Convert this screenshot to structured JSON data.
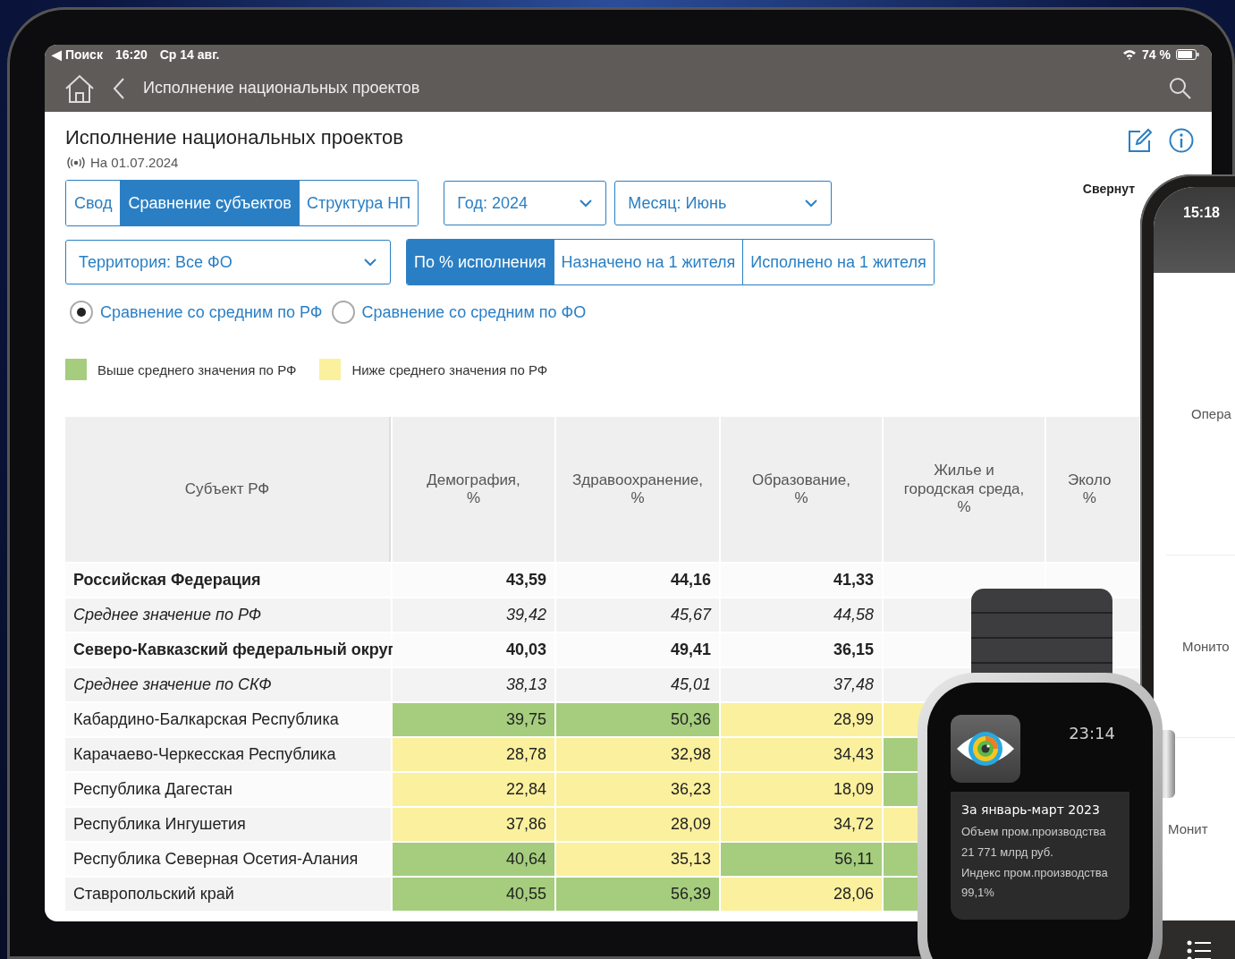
{
  "status_bar": {
    "back_label": "◀ Поиск",
    "time": "16:20",
    "date": "Ср 14 авг.",
    "battery": "74 %"
  },
  "nav_bar": {
    "title": "Исполнение национальных проектов"
  },
  "page": {
    "title": "Исполнение национальных проектов",
    "updated": "На 01.07.2024",
    "collapse": "Свернут"
  },
  "view_tabs": [
    {
      "label": "Свод",
      "selected": false
    },
    {
      "label": "Сравнение субъектов",
      "selected": true
    },
    {
      "label": "Структура НП",
      "selected": false
    }
  ],
  "year_select": {
    "value": "Год: 2024"
  },
  "month_select": {
    "value": "Месяц: Июнь"
  },
  "territory_select": {
    "value": "Территория: Все ФО"
  },
  "metric_tabs": [
    {
      "label": "По % исполнения",
      "selected": true
    },
    {
      "label": "Назначено на 1 жителя",
      "selected": false
    },
    {
      "label": "Исполнено на 1 жителя",
      "selected": false
    }
  ],
  "comparison": [
    {
      "label": "Сравнение со средним по РФ",
      "selected": true
    },
    {
      "label": "Сравнение со средним по ФО",
      "selected": false
    }
  ],
  "legend": [
    {
      "label": "Выше среднего значения по РФ",
      "color": "#a5cd7d"
    },
    {
      "label": "Ниже среднего значения по РФ",
      "color": "#fbf09d"
    }
  ],
  "table": {
    "row_header": "Субъект РФ",
    "columns": [
      "Демография,\n%",
      "Здравоохранение,\n%",
      "Образование,\n%",
      "Жилье и\nгородская среда,\n%",
      "Эколо\n%"
    ],
    "rows": [
      {
        "kind": "total",
        "name": "Российская Федерация",
        "cells": [
          {
            "value": "43,59"
          },
          {
            "value": "44,16"
          },
          {
            "value": "41,33"
          }
        ]
      },
      {
        "kind": "average",
        "name": "Среднее значение по РФ",
        "cells": [
          {
            "value": "39,42"
          },
          {
            "value": "45,67"
          },
          {
            "value": "44,58"
          }
        ]
      },
      {
        "kind": "total",
        "name": "Северо-Кавказский федеральный округ",
        "cells": [
          {
            "value": "40,03"
          },
          {
            "value": "49,41"
          },
          {
            "value": "36,15"
          }
        ]
      },
      {
        "kind": "average",
        "name": "Среднее значение по СКФ",
        "cells": [
          {
            "value": "38,13"
          },
          {
            "value": "45,01"
          },
          {
            "value": "37,48"
          }
        ]
      },
      {
        "kind": "region",
        "name": "Кабардино-Балкарская Республика",
        "cells": [
          {
            "value": "39,75",
            "color": "#a5cd7d"
          },
          {
            "value": "50,36",
            "color": "#a5cd7d"
          },
          {
            "value": "28,99",
            "color": "#fbf09d"
          },
          {
            "color": "#fbf09d"
          }
        ]
      },
      {
        "kind": "region",
        "name": "Карачаево-Черкесская Республика",
        "cells": [
          {
            "value": "28,78",
            "color": "#fbf09d"
          },
          {
            "value": "32,98",
            "color": "#fbf09d"
          },
          {
            "value": "34,43",
            "color": "#fbf09d"
          },
          {
            "color": "#a5cd7d"
          }
        ]
      },
      {
        "kind": "region",
        "name": "Республика Дагестан",
        "cells": [
          {
            "value": "22,84",
            "color": "#fbf09d"
          },
          {
            "value": "36,23",
            "color": "#fbf09d"
          },
          {
            "value": "18,09",
            "color": "#fbf09d"
          },
          {
            "color": "#a5cd7d"
          }
        ]
      },
      {
        "kind": "region",
        "name": "Республика Ингушетия",
        "cells": [
          {
            "value": "37,86",
            "color": "#fbf09d"
          },
          {
            "value": "28,09",
            "color": "#fbf09d"
          },
          {
            "value": "34,72",
            "color": "#fbf09d"
          },
          {
            "color": "#fbf09d"
          }
        ]
      },
      {
        "kind": "region",
        "name": "Республика Северная Осетия-Алания",
        "cells": [
          {
            "value": "40,64",
            "color": "#a5cd7d"
          },
          {
            "value": "35,13",
            "color": "#fbf09d"
          },
          {
            "value": "56,11",
            "color": "#a5cd7d"
          },
          {
            "color": "#a5cd7d"
          }
        ]
      },
      {
        "kind": "region",
        "name": "Ставропольский край",
        "cells": [
          {
            "value": "40,55",
            "color": "#a5cd7d"
          },
          {
            "value": "56,39",
            "color": "#a5cd7d"
          },
          {
            "value": "28,06",
            "color": "#fbf09d"
          },
          {
            "color": "#a5cd7d"
          }
        ]
      }
    ]
  },
  "phone": {
    "time": "15:18",
    "menu_items": [
      "Опера",
      "Монито",
      "Монит"
    ]
  },
  "watch": {
    "time": "23:14",
    "title": "За январь-март 2023",
    "lines": [
      "Объем пром.производства",
      "21 771 млрд руб.",
      "Индекс пром.производства",
      "99,1%"
    ]
  }
}
